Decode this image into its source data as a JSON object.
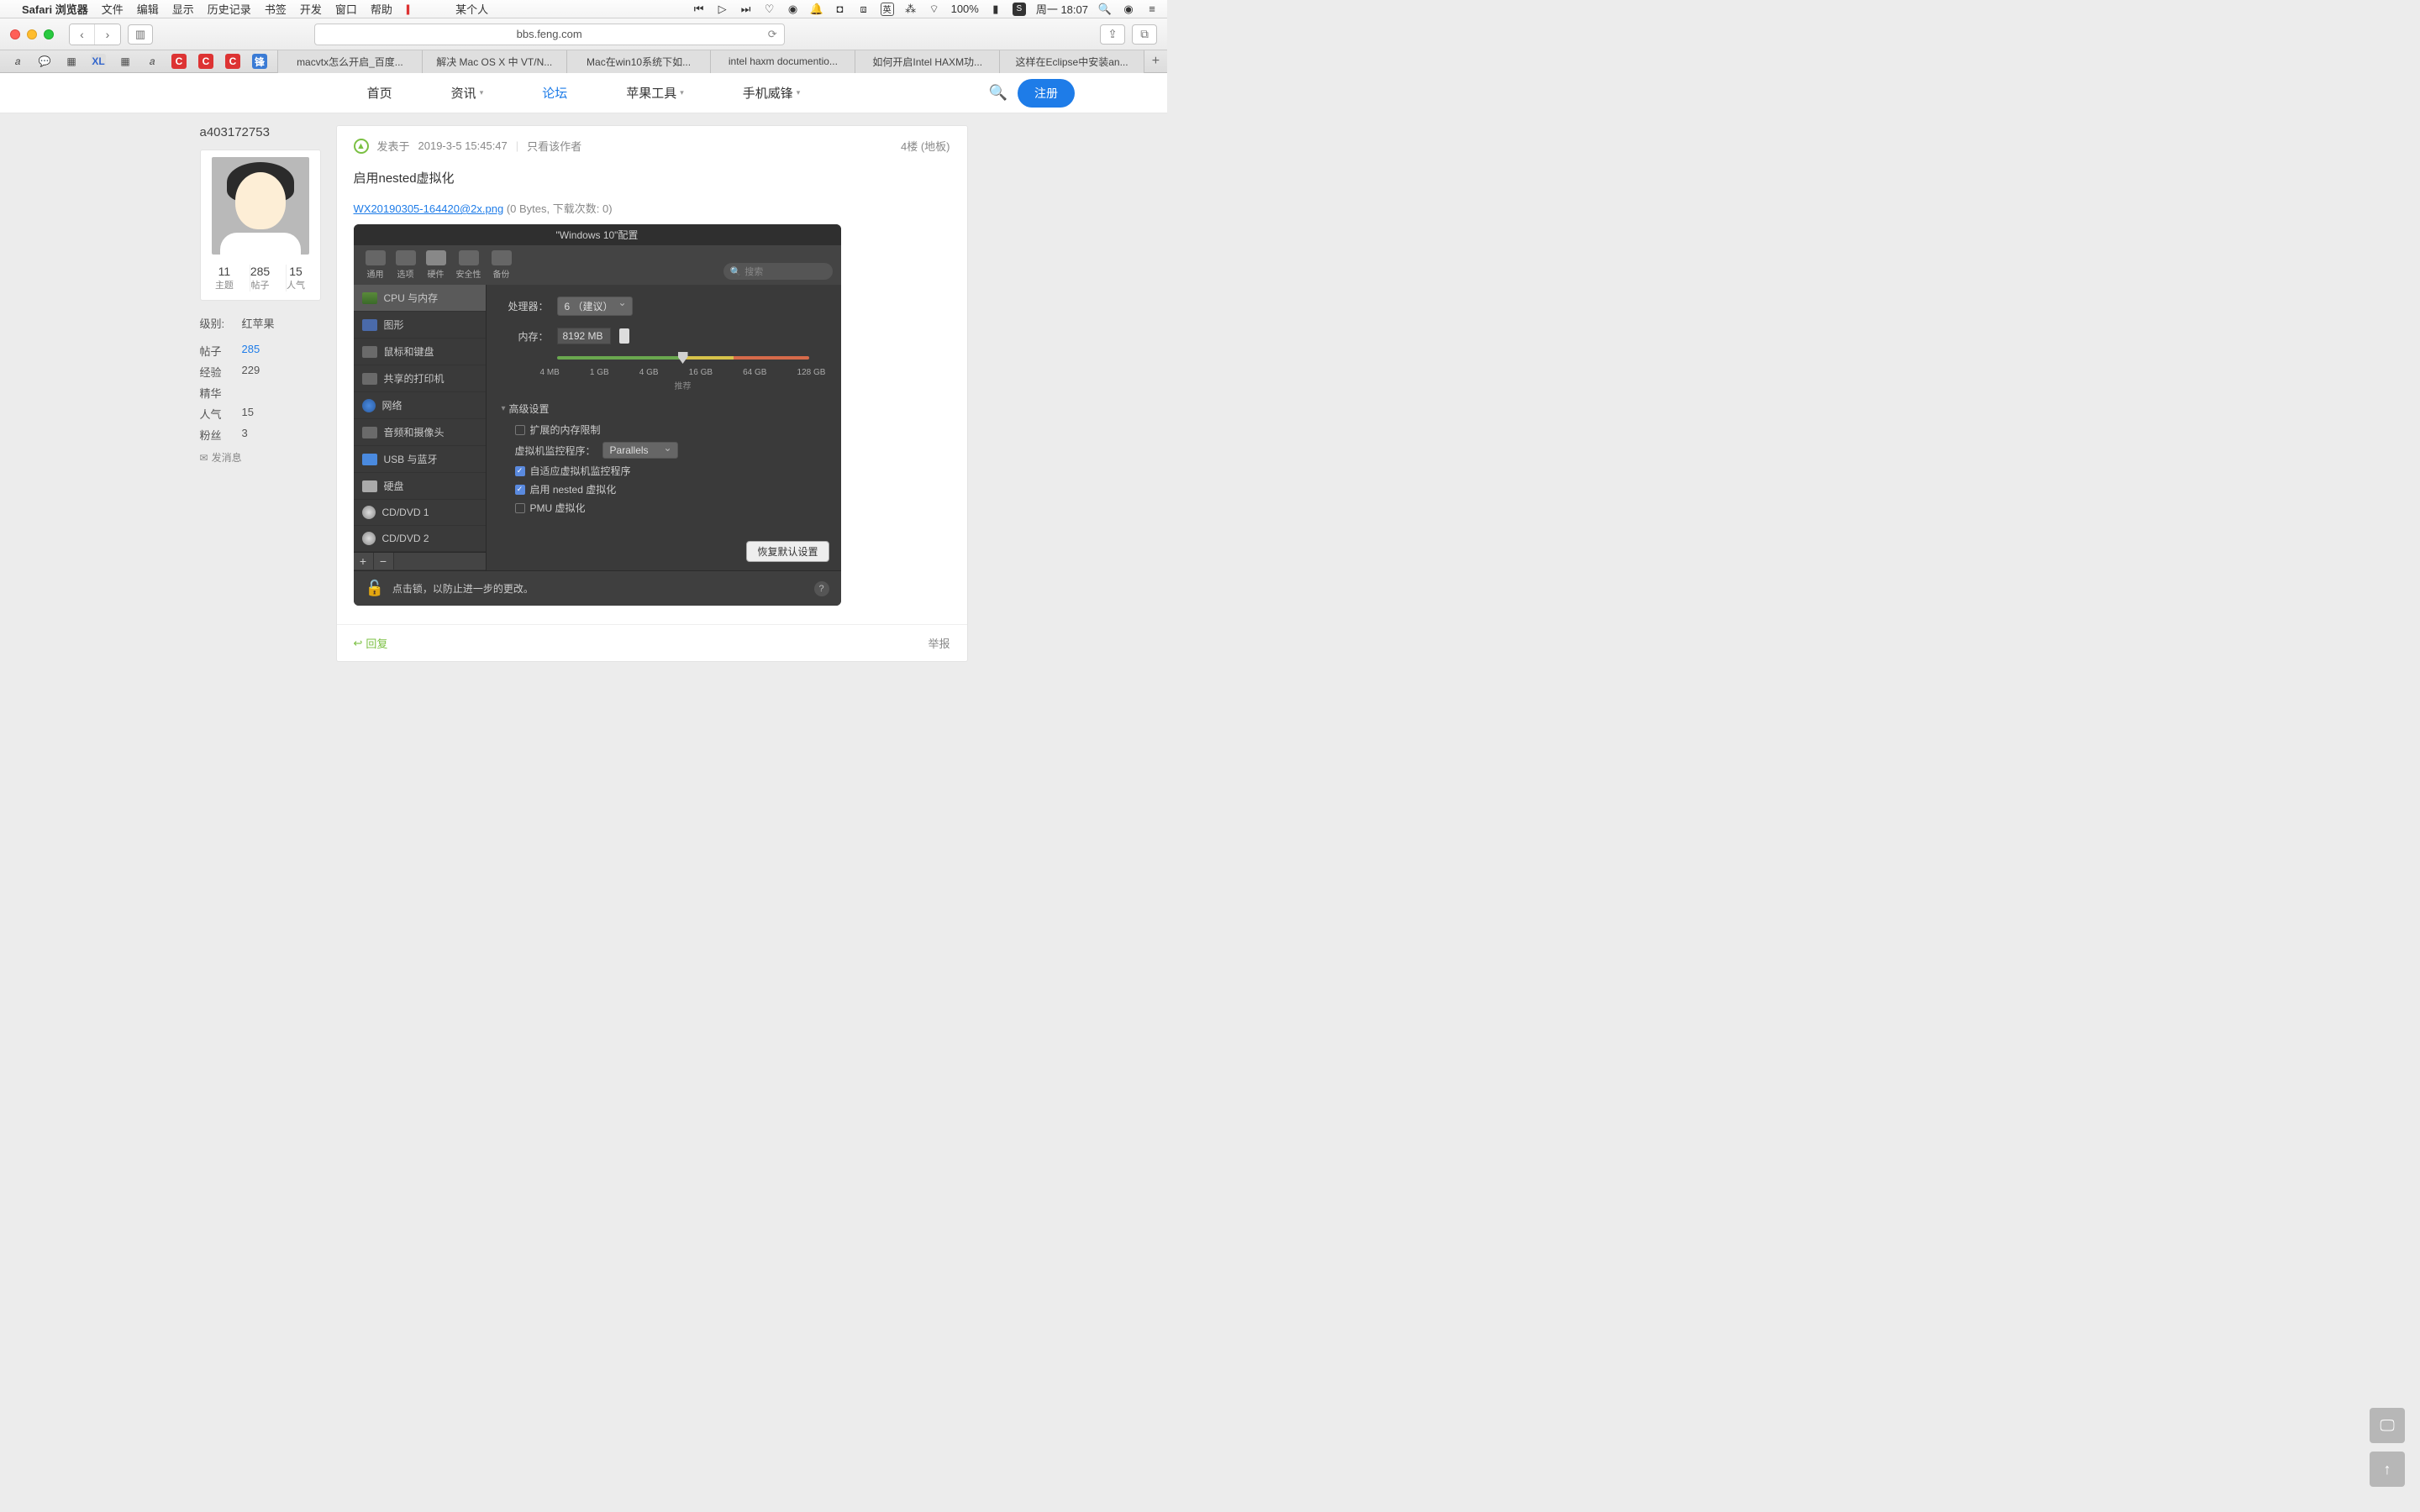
{
  "menubar": {
    "app": "Safari 浏览器",
    "items": [
      "文件",
      "编辑",
      "显示",
      "历史记录",
      "书签",
      "开发",
      "窗口",
      "帮助"
    ],
    "user": "某个人",
    "battery": "100%",
    "ime": "英",
    "clock": "周一 18:07"
  },
  "url": "bbs.feng.com",
  "tabs": [
    "macvtx怎么开启_百度...",
    "解决 Mac OS X 中 VT/N...",
    "Mac在win10系统下如...",
    "intel haxm documentio...",
    "如何开启Intel HAXM功...",
    "这样在Eclipse中安装an..."
  ],
  "nav": {
    "items": [
      "首页",
      "资讯",
      "论坛",
      "苹果工具",
      "手机威锋"
    ],
    "active_index": 2,
    "register": "注册"
  },
  "user": {
    "name": "a403172753",
    "stats": [
      {
        "num": "11",
        "lbl": "主题"
      },
      {
        "num": "285",
        "lbl": "帖子"
      },
      {
        "num": "15",
        "lbl": "人气"
      }
    ],
    "level_k": "级别:",
    "level_v": "红苹果",
    "rows": [
      {
        "k": "帖子",
        "v": "285",
        "link": true
      },
      {
        "k": "经验",
        "v": "229"
      },
      {
        "k": "精华",
        "v": ""
      },
      {
        "k": "人气",
        "v": "15"
      },
      {
        "k": "粉丝",
        "v": "3"
      }
    ],
    "msg": "发消息"
  },
  "post": {
    "posted_prefix": "发表于",
    "posted_time": "2019-3-5 15:45:47",
    "only_author": "只看该作者",
    "floor": "4楼 (地板)",
    "title": "启用nested虚拟化",
    "attach_name": "WX20190305-164420@2x.png",
    "attach_meta": "(0 Bytes, 下载次数: 0)",
    "reply": "回复",
    "report": "举报"
  },
  "pd": {
    "title": "\"Windows 10\"配置",
    "toolbar": [
      "通用",
      "选项",
      "硬件",
      "安全性",
      "备份"
    ],
    "toolbar_active": 2,
    "search_ph": "搜索",
    "side": [
      "CPU 与内存",
      "图形",
      "鼠标和键盘",
      "共享的打印机",
      "网络",
      "音频和摄像头",
      "USB 与蓝牙",
      "硬盘",
      "CD/DVD 1",
      "CD/DVD 2"
    ],
    "cpu_k": "处理器：",
    "cpu_v": "6 （建议）",
    "mem_k": "内存：",
    "mem_v": "8192 MB",
    "ticks": [
      "4 MB",
      "1 GB",
      "4 GB",
      "16 GB",
      "64 GB",
      "128 GB"
    ],
    "rec": "推荐",
    "adv": "高级设置",
    "chk_extmem": "扩展的内存限制",
    "hyp_k": "虚拟机监控程序：",
    "hyp_v": "Parallels",
    "chk_adapt": "自适应虚拟机监控程序",
    "chk_nested": "启用 nested 虚拟化",
    "chk_pmu": "PMU 虚拟化",
    "restore": "恢复默认设置",
    "lock": "点击锁，以防止进一步的更改。"
  }
}
